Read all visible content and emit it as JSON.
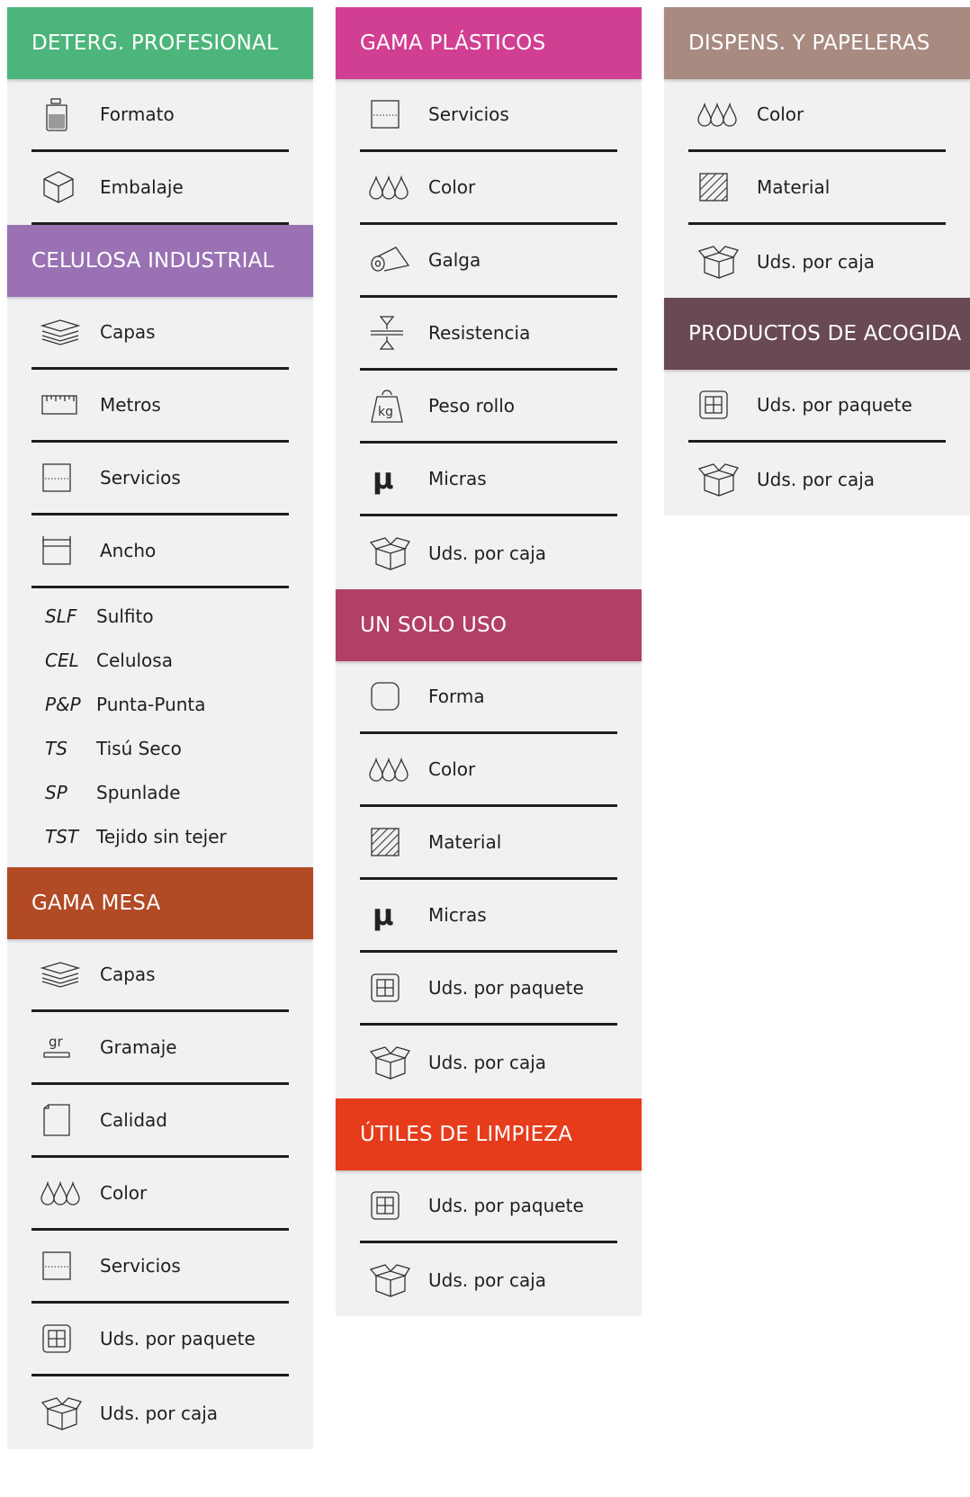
{
  "colors": {
    "deterg": "#4cb57b",
    "celulosa": "#9a72b4",
    "mesa": "#b24a25",
    "plasticos": "#d13f92",
    "solo_uso": "#b23f64",
    "utiles": "#e63c1c",
    "dispens": "#a88a81",
    "acogida": "#6a4a52"
  },
  "deterg": {
    "title": "DETERG. PROFESIONAL",
    "items": [
      {
        "label": "Formato",
        "icon": "bottle-icon"
      },
      {
        "label": "Embalaje",
        "icon": "cube-icon"
      }
    ]
  },
  "celulosa": {
    "title": "CELULOSA INDUSTRIAL",
    "items": [
      {
        "label": "Capas",
        "icon": "layers-icon"
      },
      {
        "label": "Metros",
        "icon": "ruler-icon"
      },
      {
        "label": "Servicios",
        "icon": "sheet-icon"
      },
      {
        "label": "Ancho",
        "icon": "width-icon"
      }
    ],
    "abbreviations": [
      {
        "abbr": "SLF",
        "label": "Sulfito"
      },
      {
        "abbr": "CEL",
        "label": "Celulosa"
      },
      {
        "abbr": "P&P",
        "label": "Punta-Punta"
      },
      {
        "abbr": "TS",
        "label": "Tisú Seco"
      },
      {
        "abbr": "SP",
        "label": "Spunlade"
      },
      {
        "abbr": "TST",
        "label": "Tejido sin tejer"
      }
    ]
  },
  "mesa": {
    "title": "GAMA MESA",
    "items": [
      {
        "label": "Capas",
        "icon": "layers-icon"
      },
      {
        "label": "Gramaje",
        "icon": "grams-icon",
        "icon_text": "gr"
      },
      {
        "label": "Calidad",
        "icon": "quality-icon"
      },
      {
        "label": "Color",
        "icon": "drops-icon"
      },
      {
        "label": "Servicios",
        "icon": "sheet-icon"
      },
      {
        "label": "Uds. por paquete",
        "icon": "package-icon"
      },
      {
        "label": "Uds. por caja",
        "icon": "box-icon"
      }
    ]
  },
  "plasticos": {
    "title": "GAMA PLÁSTICOS",
    "items": [
      {
        "label": "Servicios",
        "icon": "sheet-icon"
      },
      {
        "label": "Color",
        "icon": "drops-icon"
      },
      {
        "label": "Galga",
        "icon": "roll-icon"
      },
      {
        "label": "Resistencia",
        "icon": "resistance-icon"
      },
      {
        "label": "Peso rollo",
        "icon": "weight-icon",
        "icon_text": "kg"
      },
      {
        "label": "Micras",
        "icon": "micron-icon",
        "icon_text": "μ"
      },
      {
        "label": "Uds. por caja",
        "icon": "box-icon"
      }
    ]
  },
  "solo_uso": {
    "title": "UN SOLO USO",
    "items": [
      {
        "label": "Forma",
        "icon": "shape-icon"
      },
      {
        "label": "Color",
        "icon": "drops-icon"
      },
      {
        "label": "Material",
        "icon": "material-icon"
      },
      {
        "label": "Micras",
        "icon": "micron-icon",
        "icon_text": "μ"
      },
      {
        "label": "Uds. por paquete",
        "icon": "package-icon"
      },
      {
        "label": "Uds. por caja",
        "icon": "box-icon"
      }
    ]
  },
  "utiles": {
    "title": "ÚTILES DE LIMPIEZA",
    "items": [
      {
        "label": "Uds. por paquete",
        "icon": "package-icon"
      },
      {
        "label": "Uds. por caja",
        "icon": "box-icon"
      }
    ]
  },
  "dispens": {
    "title": "DISPENS. Y PAPELERAS",
    "items": [
      {
        "label": "Color",
        "icon": "drops-icon"
      },
      {
        "label": "Material",
        "icon": "material-icon"
      },
      {
        "label": "Uds. por caja",
        "icon": "box-icon"
      }
    ]
  },
  "acogida": {
    "title": "PRODUCTOS DE ACOGIDA",
    "items": [
      {
        "label": "Uds. por paquete",
        "icon": "package-icon"
      },
      {
        "label": "Uds. por caja",
        "icon": "box-icon"
      }
    ]
  }
}
